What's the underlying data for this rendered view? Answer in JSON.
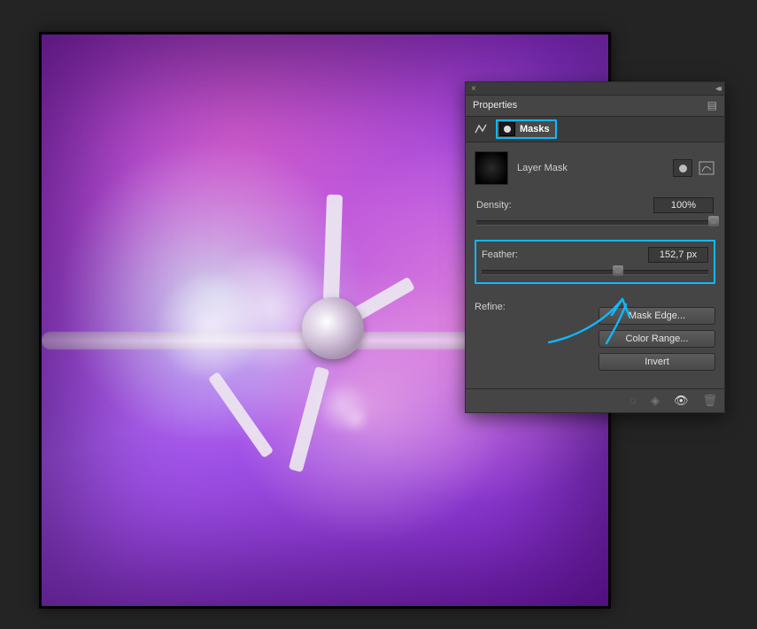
{
  "panel": {
    "title": "Properties",
    "tabs": {
      "masks_label": "Masks"
    },
    "layer_mask_label": "Layer Mask",
    "density": {
      "label": "Density:",
      "value": "100%",
      "percent": 100
    },
    "feather": {
      "label": "Feather:",
      "value": "152,7 px",
      "percent": 60
    },
    "refine": {
      "label": "Refine:",
      "mask_edge": "Mask Edge...",
      "color_range": "Color Range...",
      "invert": "Invert"
    }
  },
  "annotation": {
    "highlight_targets": [
      "masks-tab",
      "feather-row"
    ],
    "arrow_from": "feather-row",
    "arrow_to": "mask-edge-button",
    "stroke": "#10b8ff"
  }
}
